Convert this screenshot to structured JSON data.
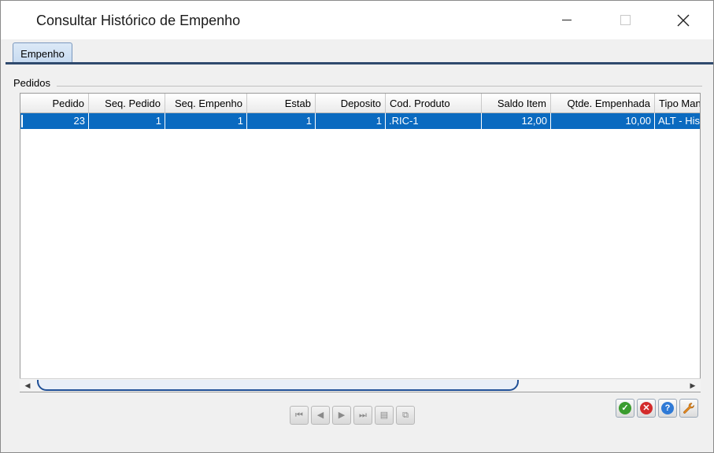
{
  "window": {
    "title": "Consultar Histórico de Empenho",
    "controls": {
      "minimize": "",
      "maximize": "",
      "close": "✕"
    }
  },
  "tabs": [
    {
      "label": "Empenho",
      "active": true
    }
  ],
  "group": {
    "label": "Pedidos"
  },
  "grid": {
    "columns": [
      "Pedido",
      "Seq. Pedido",
      "Seq. Empenho",
      "Estab",
      "Deposito",
      "Cod. Produto",
      "Saldo Item",
      "Qtde. Empenhada",
      "Tipo Man"
    ],
    "rows": [
      [
        "23",
        "1",
        "1",
        "1",
        "1",
        ".RIC-1",
        "12,00",
        "10,00",
        "ALT - His"
      ]
    ],
    "selected_row": 0
  },
  "scrollbar": {
    "left_arrow": "◀",
    "right_arrow": "▶"
  },
  "navigation": {
    "first": "⏮",
    "prev": "◀",
    "next": "▶",
    "last": "⏭",
    "detail": "▤",
    "export": "⧉"
  },
  "actions": {
    "confirm": "✓",
    "cancel": "✕",
    "help": "?"
  },
  "colors": {
    "selection": "#0a6ac0",
    "tab_rule": "#2f4a6e",
    "scroll_thumb": "#1f4f96"
  }
}
